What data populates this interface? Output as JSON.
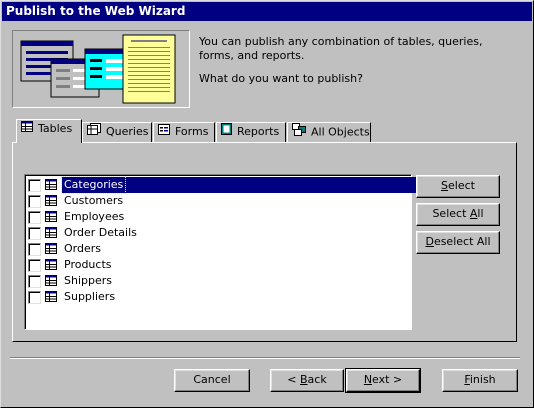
{
  "window": {
    "title": "Publish to the Web Wizard"
  },
  "intro": {
    "text": "You can publish any combination of tables, queries, forms, and reports.",
    "question": "What do you want to publish?"
  },
  "tabs": [
    {
      "label": "Tables",
      "icon": "table-icon",
      "active": true
    },
    {
      "label": "Queries",
      "icon": "query-icon"
    },
    {
      "label": "Forms",
      "icon": "form-icon"
    },
    {
      "label": "Reports",
      "icon": "report-icon"
    },
    {
      "label": "All Objects",
      "icon": "all-objects-icon"
    }
  ],
  "items": [
    {
      "label": "Categories",
      "checked": false,
      "selected": true
    },
    {
      "label": "Customers",
      "checked": false
    },
    {
      "label": "Employees",
      "checked": false
    },
    {
      "label": "Order Details",
      "checked": false
    },
    {
      "label": "Orders",
      "checked": false
    },
    {
      "label": "Products",
      "checked": false
    },
    {
      "label": "Shippers",
      "checked": false
    },
    {
      "label": "Suppliers",
      "checked": false
    }
  ],
  "side_buttons": {
    "select_pre": "",
    "select_u": "S",
    "select_post": "elect",
    "select_all_pre": "Select ",
    "select_all_u": "A",
    "select_all_post": "ll",
    "deselect_all_pre": "",
    "deselect_all_u": "D",
    "deselect_all_post": "eselect All"
  },
  "footer": {
    "cancel": "Cancel",
    "back_pre": "< ",
    "back_u": "B",
    "back_post": "ack",
    "next_pre": "",
    "next_u": "N",
    "next_post": "ext >",
    "finish_pre": "",
    "finish_u": "F",
    "finish_post": "inish"
  },
  "colors": {
    "face": "#c0c0c0",
    "title_bg": "#000080",
    "selection": "#000080"
  }
}
